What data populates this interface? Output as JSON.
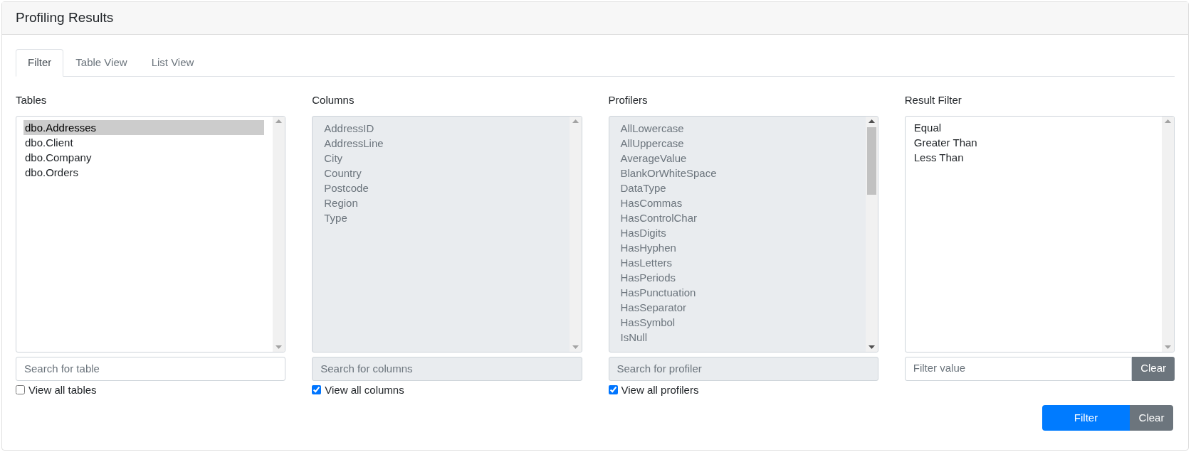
{
  "header": {
    "title": "Profiling Results"
  },
  "tabs": [
    {
      "label": "Filter",
      "selected": true
    },
    {
      "label": "Table View",
      "selected": false
    },
    {
      "label": "List View",
      "selected": false
    }
  ],
  "panels": [
    {
      "label": "Tables",
      "disabled": false,
      "more_below": false,
      "items": [
        {
          "text": "dbo.Addresses",
          "selected": true
        },
        {
          "text": "dbo.Client",
          "selected": false
        },
        {
          "text": "dbo.Company",
          "selected": false
        },
        {
          "text": "dbo.Orders",
          "selected": false
        }
      ],
      "search": {
        "placeholder": "Search for table"
      },
      "view_all": {
        "label": "View all tables",
        "checked": false
      }
    },
    {
      "label": "Columns",
      "disabled": true,
      "more_below": false,
      "items": [
        {
          "text": "AddressID",
          "selected": false
        },
        {
          "text": "AddressLine",
          "selected": false
        },
        {
          "text": "City",
          "selected": false
        },
        {
          "text": "Country",
          "selected": false
        },
        {
          "text": "Postcode",
          "selected": false
        },
        {
          "text": "Region",
          "selected": false
        },
        {
          "text": "Type",
          "selected": false
        }
      ],
      "search": {
        "placeholder": "Search for columns"
      },
      "view_all": {
        "label": "View all columns",
        "checked": true
      }
    },
    {
      "label": "Profilers",
      "disabled": true,
      "more_below": true,
      "items": [
        {
          "text": "AllLowercase",
          "selected": false
        },
        {
          "text": "AllUppercase",
          "selected": false
        },
        {
          "text": "AverageValue",
          "selected": false
        },
        {
          "text": "BlankOrWhiteSpace",
          "selected": false
        },
        {
          "text": "DataType",
          "selected": false
        },
        {
          "text": "HasCommas",
          "selected": false
        },
        {
          "text": "HasControlChar",
          "selected": false
        },
        {
          "text": "HasDigits",
          "selected": false
        },
        {
          "text": "HasHyphen",
          "selected": false
        },
        {
          "text": "HasLetters",
          "selected": false
        },
        {
          "text": "HasPeriods",
          "selected": false
        },
        {
          "text": "HasPunctuation",
          "selected": false
        },
        {
          "text": "HasSeparator",
          "selected": false
        },
        {
          "text": "HasSymbol",
          "selected": false
        },
        {
          "text": "IsNull",
          "selected": false
        }
      ],
      "search": {
        "placeholder": "Search for profiler"
      },
      "view_all": {
        "label": "View all profilers",
        "checked": true
      }
    },
    {
      "label": "Result Filter",
      "disabled": false,
      "more_below": false,
      "items": [
        {
          "text": "Equal",
          "selected": false
        },
        {
          "text": "Greater Than",
          "selected": false
        },
        {
          "text": "Less Than",
          "selected": false
        }
      ],
      "search": {
        "placeholder": "Filter value",
        "button": "Clear"
      }
    }
  ],
  "actions": {
    "primary": "Filter",
    "secondary": "Clear"
  }
}
